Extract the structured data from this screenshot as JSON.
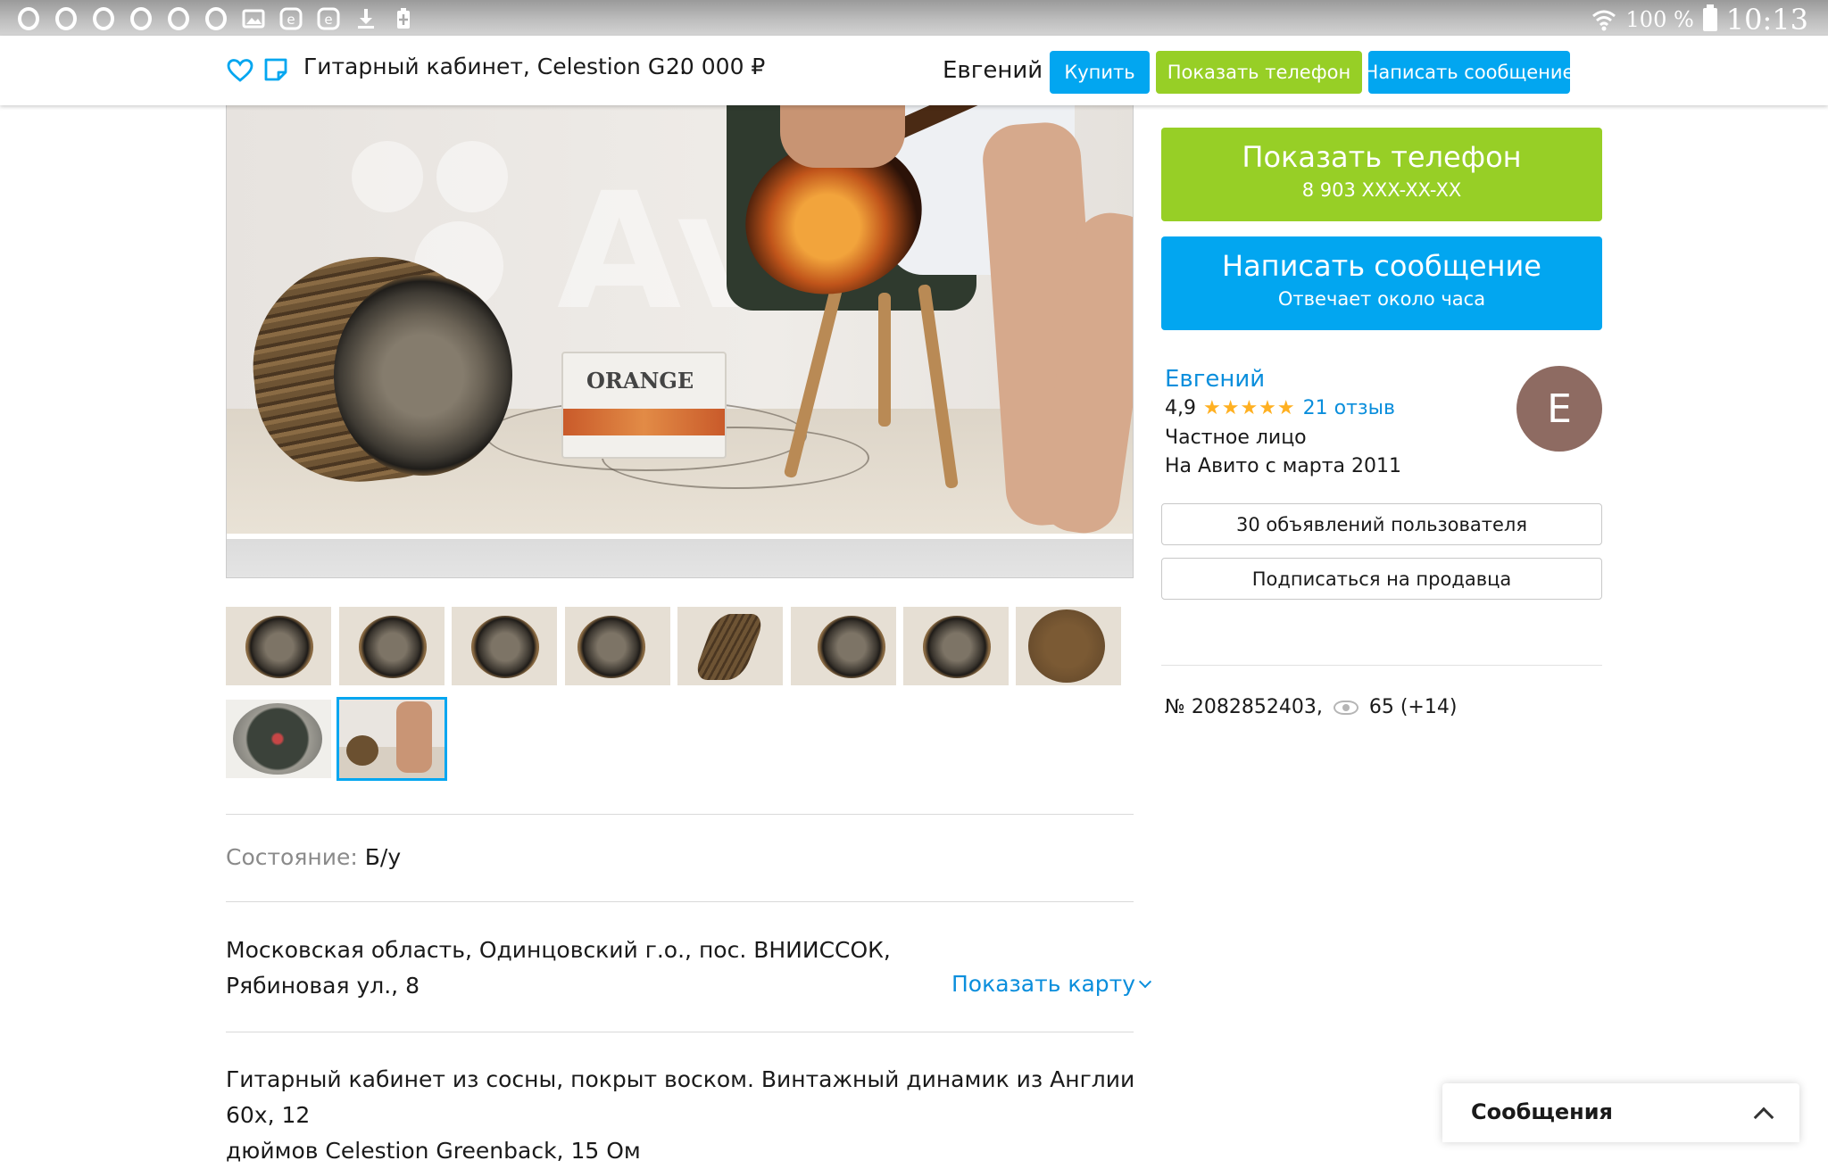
{
  "status_bar": {
    "battery_percent": "100 %",
    "time": "10:13",
    "notification_icons": [
      "opera-icon",
      "opera-icon",
      "opera-icon",
      "opera-icon",
      "opera-icon",
      "opera-icon",
      "gallery-icon",
      "e-icon",
      "e-icon",
      "download-icon",
      "battery-saver-icon"
    ]
  },
  "header": {
    "title": "Гитарный кабинет, Celestion G...",
    "price": "20 000  ₽",
    "seller": "Евгений",
    "buy_label": "Купить",
    "phone_label": "Показать телефон",
    "message_label": "Написать сообщение"
  },
  "gallery": {
    "watermark": "Av",
    "amp_label": "ORANGE",
    "thumb_count": 10,
    "selected_index": 9
  },
  "details": {
    "condition_label": "Состояние:",
    "condition_value": "Б/у",
    "address_line1": "Московская область, Одинцовский г.о., пос. ВНИИССОК,",
    "address_line2": "Рябиновая ул., 8",
    "show_map": "Показать карту",
    "description_line1": "Гитарный кабинет из сосны, покрыт воском. Винтажный динамик из Англии 60х, 12",
    "description_line2": "дюймов Celestion Greenback, 15 Ом"
  },
  "sidebar": {
    "phone_button": "Показать телефон",
    "phone_number": "8 903 XXX-XX-XX",
    "message_button": "Написать сообщение",
    "message_sub": "Отвечает около часа",
    "seller_name": "Евгений",
    "rating": "4,9",
    "stars": "★★★★★",
    "rating_value": 4.9,
    "reviews": "21 отзыв",
    "seller_type": "Частное лицо",
    "since": "На Авито с марта 2011",
    "avatar_letter": "Е",
    "ads_button": "30 объявлений пользователя",
    "subscribe_button": "Подписаться на продавца",
    "ad_number": "№ 2082852403,",
    "views": "65 (+14)"
  },
  "messages_widget": {
    "title": "Сообщения"
  },
  "colors": {
    "blue": "#02a6f0",
    "green": "#97cf26",
    "link": "#0a8edc",
    "star": "#ffb021"
  }
}
